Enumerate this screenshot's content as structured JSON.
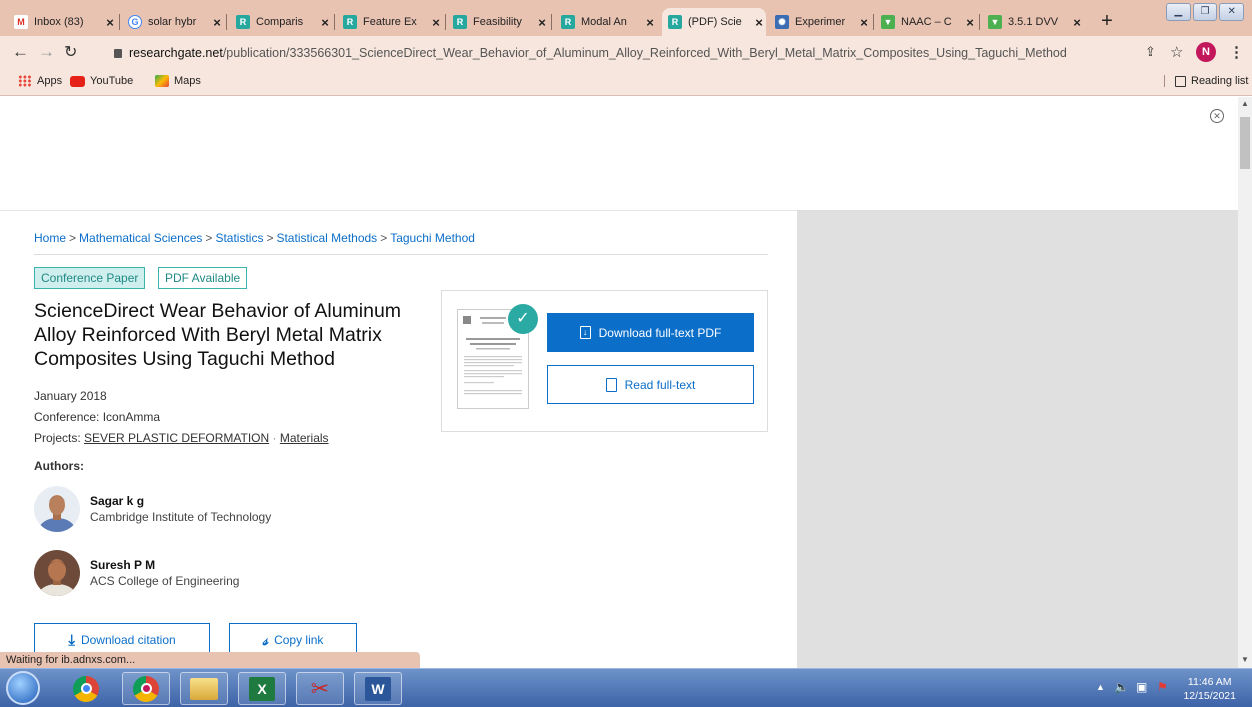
{
  "browser": {
    "tabs": [
      {
        "label": "Inbox (83)",
        "favicon": "gmail-icon",
        "active": false
      },
      {
        "label": "solar hybr",
        "favicon": "google-icon",
        "active": false
      },
      {
        "label": "Comparis",
        "favicon": "researchgate-icon",
        "active": false
      },
      {
        "label": "Feature Ex",
        "favicon": "researchgate-icon",
        "active": false
      },
      {
        "label": "Feasibility",
        "favicon": "researchgate-icon",
        "active": false
      },
      {
        "label": "Modal An",
        "favicon": "researchgate-icon",
        "active": false
      },
      {
        "label": "(PDF) Scie",
        "favicon": "researchgate-icon",
        "active": true
      },
      {
        "label": "Experimer",
        "favicon": "atom-icon",
        "active": false
      },
      {
        "label": "NAAC – C",
        "favicon": "naac-icon",
        "active": false
      },
      {
        "label": "3.5.1 DVV",
        "favicon": "naac-icon",
        "active": false
      }
    ],
    "url_host": "researchgate.net",
    "url_path": "/publication/333566301_ScienceDirect_Wear_Behavior_of_Aluminum_Alloy_Reinforced_With_Beryl_Metal_Matrix_Composites_Using_Taguchi_Method",
    "profile_initial": "N",
    "bookmarks": [
      {
        "label": "Apps",
        "icon": "apps-grid-icon"
      },
      {
        "label": "YouTube",
        "icon": "youtube-icon"
      },
      {
        "label": "Maps",
        "icon": "maps-icon"
      }
    ],
    "reading_list": "Reading list",
    "status_text": "Waiting for ib.adnxs.com..."
  },
  "page": {
    "breadcrumb": [
      "Home",
      "Mathematical Sciences",
      "Statistics",
      "Statistical Methods",
      "Taguchi Method"
    ],
    "type_badge": "Conference Paper",
    "pdf_badge": "PDF Available",
    "title": "ScienceDirect Wear Behavior of Aluminum Alloy Reinforced With Beryl Metal Matrix Composites Using Taguchi Method",
    "date": "January 2018",
    "conference": "Conference: IconAmma",
    "projects_label": "Projects:",
    "projects": [
      "SEVER PLASTIC DEFORMATION",
      "Materials"
    ],
    "authors_label": "Authors:",
    "authors": [
      {
        "name": "Sagar k g",
        "affiliation": "Cambridge Institute of Technology"
      },
      {
        "name": "Suresh P M",
        "affiliation": "ACS College of Engineering"
      }
    ],
    "download_pdf": "Download full-text PDF",
    "read_fulltext": "Read full-text",
    "download_citation": "Download citation",
    "copy_link": "Copy link"
  },
  "taskbar": {
    "time": "11:46 AM",
    "date": "12/15/2021"
  },
  "colors": {
    "accent": "#0b6ec9",
    "teal": "#2baaa3",
    "chrome_frame": "#e9c3b2"
  }
}
